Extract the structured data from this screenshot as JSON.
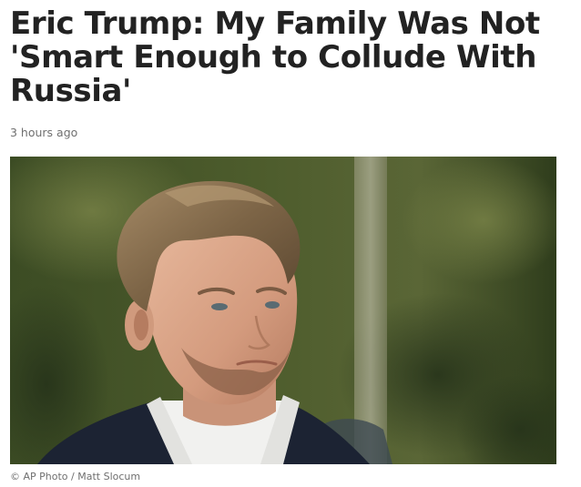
{
  "article": {
    "headline": "Eric Trump: My Family Was Not 'Smart Enough to Collude With Russia'",
    "timestamp": "3 hours ago",
    "photo_credit": "© AP Photo / Matt Slocum"
  },
  "colors": {
    "headline": "#222222",
    "meta_text": "#6f6f6f",
    "background": "#ffffff"
  }
}
